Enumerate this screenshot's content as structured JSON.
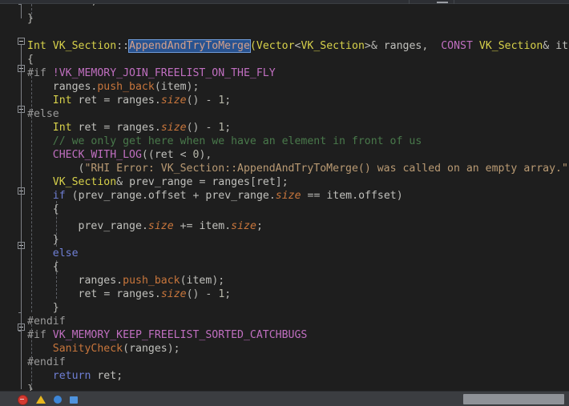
{
  "window": {
    "theme_background": "#1e1e1e",
    "chrome_background": "#2d2f34",
    "statusbar_background": "#3b3d41"
  },
  "editor": {
    "clipped_top_line": "return ret;",
    "selection": {
      "text": "AppendAndTryToMerge",
      "background": "#28528f",
      "border": "#6f9ad6"
    },
    "colors": {
      "keyword": "#6f7fd4",
      "type": "#d7d14a",
      "identifier": "#c0c0bc",
      "function": "#c8763c",
      "member": "#c8763c",
      "preprocessor": "#9a9a9a",
      "macro": "#c06fc0",
      "comment": "#49794b",
      "string": "#b99a73",
      "number": "#b6b6a8",
      "punctuation": "#b8b8b4"
    },
    "lines": [
      {
        "indent": 0,
        "text": "}"
      },
      {
        "indent": 0,
        "text": ""
      },
      {
        "indent": 0,
        "text": "Int VK_Section::AppendAndTryToMerge(Vector<VK_Section>& ranges, CONST VK_Section& item)"
      },
      {
        "indent": 0,
        "text": "{"
      },
      {
        "indent": 0,
        "text": "#if !VK_MEMORY_JOIN_FREELIST_ON_THE_FLY"
      },
      {
        "indent": 1,
        "text": "ranges.push_back(item);"
      },
      {
        "indent": 1,
        "text": "Int ret = ranges.size() - 1;"
      },
      {
        "indent": 0,
        "text": "#else"
      },
      {
        "indent": 1,
        "text": "Int ret = ranges.size() - 1;"
      },
      {
        "indent": 1,
        "text": "// we only get here when we have an element in front of us"
      },
      {
        "indent": 1,
        "text": "CHECK_WITH_LOG((ret < 0),"
      },
      {
        "indent": 2,
        "text": "(\"RHI Error: VK_Section::AppendAndTryToMerge() was called on an empty array.\"))"
      },
      {
        "indent": 1,
        "text": "VK_Section& prev_range = ranges[ret];"
      },
      {
        "indent": 1,
        "text": "if (prev_range.offset + prev_range.size == item.offset)"
      },
      {
        "indent": 1,
        "text": "{"
      },
      {
        "indent": 2,
        "text": "prev_range.size += item.size;"
      },
      {
        "indent": 1,
        "text": "}"
      },
      {
        "indent": 1,
        "text": "else"
      },
      {
        "indent": 1,
        "text": "{"
      },
      {
        "indent": 2,
        "text": "ranges.push_back(item);"
      },
      {
        "indent": 2,
        "text": "ret = ranges.size() - 1;"
      },
      {
        "indent": 1,
        "text": "}"
      },
      {
        "indent": 0,
        "text": "#endif"
      },
      {
        "indent": 0,
        "text": "#if VK_MEMORY_KEEP_FREELIST_SORTED_CATCHBUGS"
      },
      {
        "indent": 1,
        "text": "SanityCheck(ranges);"
      },
      {
        "indent": 0,
        "text": "#endif"
      },
      {
        "indent": 1,
        "text": "return ret;"
      },
      {
        "indent": 0,
        "text": "}"
      }
    ]
  },
  "statusbar": {
    "icons": [
      "error-icon",
      "warning-icon",
      "info-icon",
      "message-icon"
    ],
    "search_placeholder": ""
  }
}
